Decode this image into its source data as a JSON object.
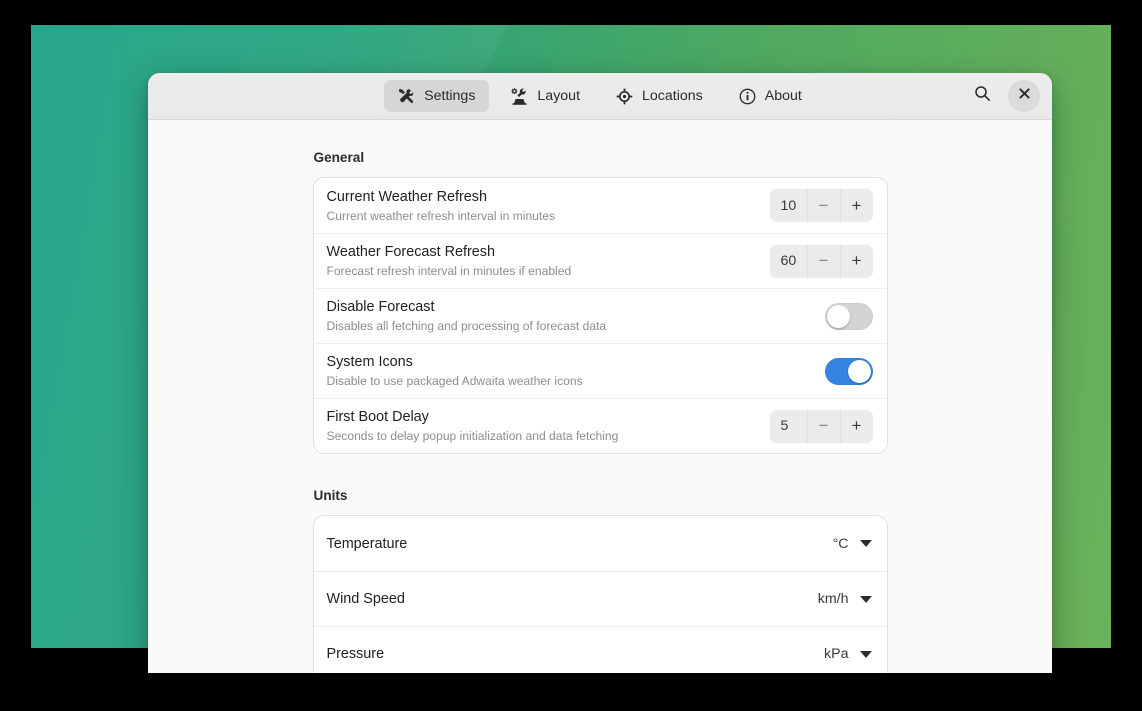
{
  "header": {
    "tabs": [
      {
        "label": "Settings",
        "icon": "tools-icon",
        "active": true
      },
      {
        "label": "Layout",
        "icon": "preferences-other-icon",
        "active": false
      },
      {
        "label": "Locations",
        "icon": "location-crosshair-icon",
        "active": false
      },
      {
        "label": "About",
        "icon": "info-circle-icon",
        "active": false
      }
    ],
    "search_label": "Search",
    "close_label": "Close"
  },
  "sections": [
    {
      "title": "General",
      "rows": [
        {
          "title": "Current Weather Refresh",
          "subtitle": "Current weather refresh interval in minutes",
          "control": "spin",
          "value": "10",
          "minus_label": "−",
          "plus_label": "+"
        },
        {
          "title": "Weather Forecast Refresh",
          "subtitle": "Forecast refresh interval in minutes if enabled",
          "control": "spin",
          "value": "60",
          "minus_label": "−",
          "plus_label": "+"
        },
        {
          "title": "Disable Forecast",
          "subtitle": "Disables all fetching and processing of forecast data",
          "control": "toggle",
          "value": "off"
        },
        {
          "title": "System Icons",
          "subtitle": "Disable to use packaged Adwaita weather icons",
          "control": "toggle",
          "value": "on"
        },
        {
          "title": "First Boot Delay",
          "subtitle": "Seconds to delay popup initialization and data fetching",
          "control": "spin",
          "value": "5",
          "minus_label": "−",
          "plus_label": "+"
        }
      ]
    },
    {
      "title": "Units",
      "rows": [
        {
          "title": "Temperature",
          "subtitle": "",
          "control": "dropdown",
          "value": "°C"
        },
        {
          "title": "Wind Speed",
          "subtitle": "",
          "control": "dropdown",
          "value": "km/h"
        },
        {
          "title": "Pressure",
          "subtitle": "",
          "control": "dropdown",
          "value": "kPa"
        }
      ]
    }
  ],
  "colors": {
    "accent": "#3584e4",
    "headerbar": "#ececec",
    "content_bg": "#fafafa",
    "card_bg": "#ffffff",
    "desktop_start": "#1da186",
    "desktop_end": "#6bb259"
  }
}
